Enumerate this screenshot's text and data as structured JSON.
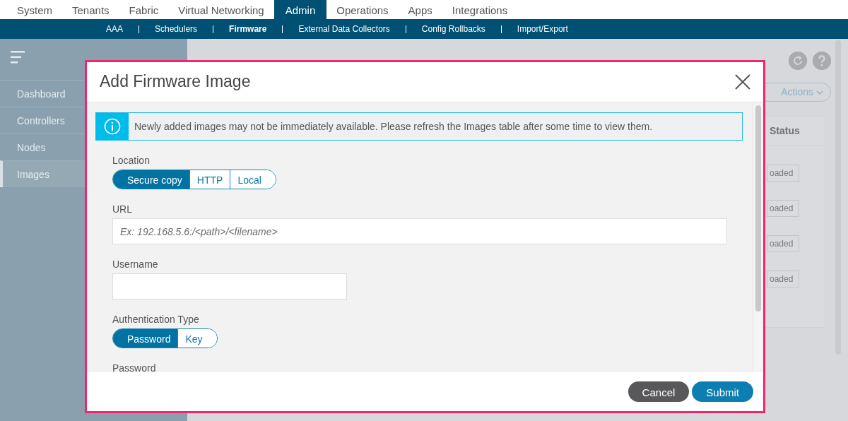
{
  "top_nav": [
    {
      "label": "System",
      "selected": false
    },
    {
      "label": "Tenants",
      "selected": false
    },
    {
      "label": "Fabric",
      "selected": false
    },
    {
      "label": "Virtual Networking",
      "selected": false
    },
    {
      "label": "Admin",
      "selected": true
    },
    {
      "label": "Operations",
      "selected": false
    },
    {
      "label": "Apps",
      "selected": false
    },
    {
      "label": "Integrations",
      "selected": false
    }
  ],
  "sub_nav": [
    {
      "label": "AAA",
      "selected": false
    },
    {
      "label": "Schedulers",
      "selected": false
    },
    {
      "label": "Firmware",
      "selected": true
    },
    {
      "label": "External Data Collectors",
      "selected": false
    },
    {
      "label": "Config Rollbacks",
      "selected": false
    },
    {
      "label": "Import/Export",
      "selected": false
    }
  ],
  "sidebar": {
    "items": [
      {
        "label": "Dashboard",
        "selected": false
      },
      {
        "label": "Controllers",
        "selected": false
      },
      {
        "label": "Nodes",
        "selected": false
      },
      {
        "label": "Images",
        "selected": true
      }
    ]
  },
  "background": {
    "actions_button": "Actions",
    "table": {
      "column": "Status",
      "rows": [
        "oaded",
        "oaded",
        "oaded",
        "oaded"
      ]
    }
  },
  "modal": {
    "title": "Add Firmware Image",
    "alert": "Newly added images may not be immediately available. Please refresh the Images table after some time to view them.",
    "fields": [
      {
        "kind": "segmented",
        "label": "Location",
        "options": [
          {
            "label": "Secure copy",
            "selected": true
          },
          {
            "label": "HTTP",
            "selected": false
          },
          {
            "label": "Local",
            "selected": false
          }
        ]
      },
      {
        "kind": "text",
        "label": "URL",
        "wide": true,
        "placeholder": "Ex: 192.168.5.6:/<path>/<filename>"
      },
      {
        "kind": "text",
        "label": "Username",
        "wide": false
      },
      {
        "kind": "segmented",
        "label": "Authentication Type",
        "options": [
          {
            "label": "Password",
            "selected": true
          },
          {
            "label": "Key",
            "selected": false
          }
        ]
      },
      {
        "kind": "label",
        "label": "Password"
      }
    ],
    "buttons": [
      {
        "label": "Cancel",
        "kind": "secondary"
      },
      {
        "label": "Submit",
        "kind": "primary"
      }
    ]
  }
}
